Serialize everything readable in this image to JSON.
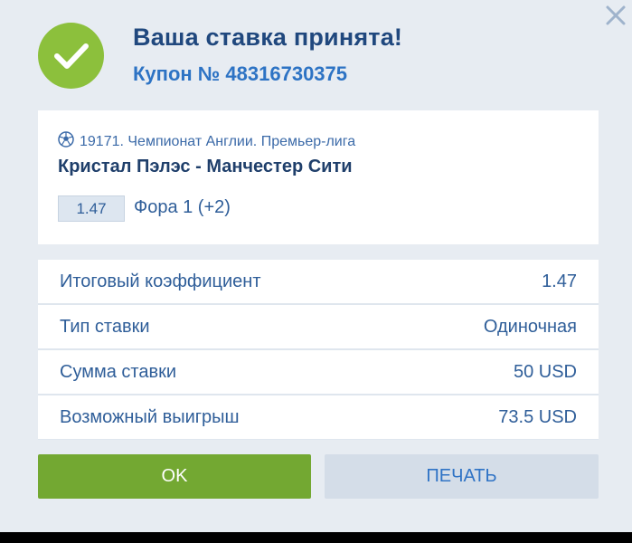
{
  "header": {
    "title": "Ваша ставка принята!",
    "coupon_text": "Купон № 48316730375"
  },
  "event": {
    "league": "19171. Чемпионат Англии. Премьер-лига",
    "match": "Кристал Пэлэс - Манчестер Сити",
    "odds": "1.47",
    "bet": "Фора 1 (+2)"
  },
  "summary": [
    {
      "label": "Итоговый коэффициент",
      "value": "1.47"
    },
    {
      "label": "Тип ставки",
      "value": "Одиночная"
    },
    {
      "label": "Сумма ставки",
      "value": "50 USD"
    },
    {
      "label": "Возможный выигрыш",
      "value": "73.5 USD"
    }
  ],
  "buttons": {
    "ok": "OK",
    "print": "ПЕЧАТЬ"
  },
  "icons": [
    "close-icon",
    "checkmark-icon",
    "soccer-ball-icon"
  ],
  "colors": {
    "accent_green": "#8cc03c",
    "button_green": "#73a832",
    "title_blue": "#20487e",
    "link_blue": "#2d73c4",
    "background": "#e7ecf2"
  }
}
